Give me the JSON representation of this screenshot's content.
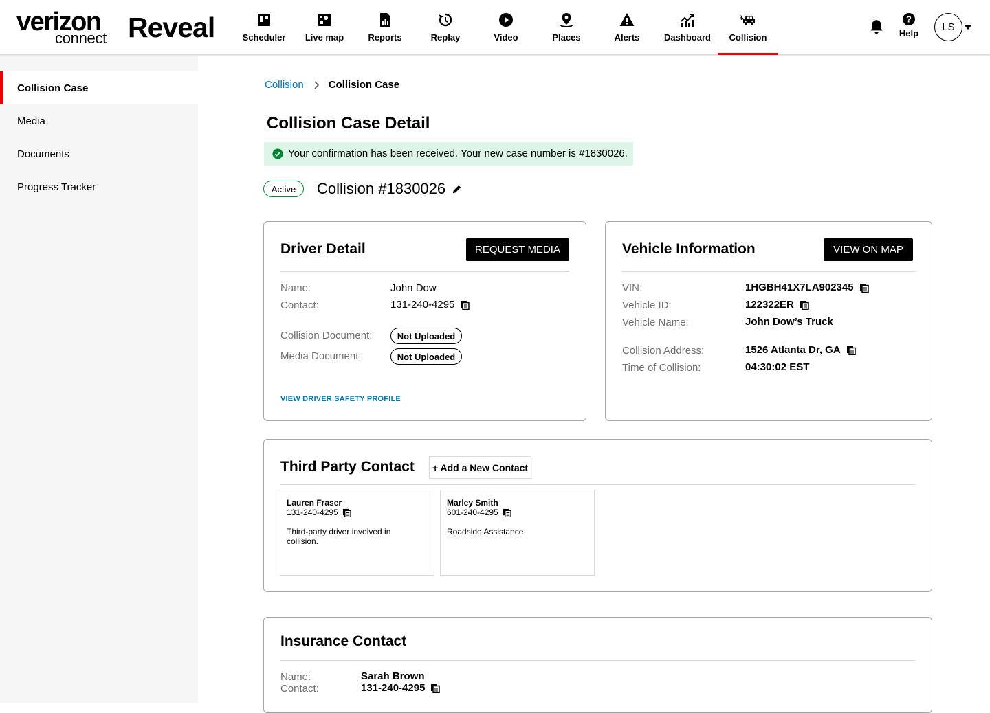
{
  "header": {
    "logo_main": "verizon",
    "logo_sub": "connect",
    "brand": "Reveal",
    "nav": [
      {
        "label": "Scheduler",
        "icon": "scheduler-icon"
      },
      {
        "label": "Live map",
        "icon": "live-map-icon"
      },
      {
        "label": "Reports",
        "icon": "reports-icon"
      },
      {
        "label": "Replay",
        "icon": "replay-icon"
      },
      {
        "label": "Video",
        "icon": "video-play-icon"
      },
      {
        "label": "Places",
        "icon": "places-pin-icon"
      },
      {
        "label": "Alerts",
        "icon": "alert-triangle-icon"
      },
      {
        "label": "Dashboard",
        "icon": "dashboard-chart-icon"
      },
      {
        "label": "Collision",
        "icon": "collision-car-icon",
        "active": true
      }
    ],
    "help_label": "Help",
    "avatar_initials": "LS"
  },
  "sidebar": {
    "items": [
      {
        "label": "Collision Case",
        "active": true
      },
      {
        "label": "Media"
      },
      {
        "label": "Documents"
      },
      {
        "label": "Progress Tracker"
      }
    ]
  },
  "breadcrumb": {
    "parent": "Collision",
    "current": "Collision Case"
  },
  "page": {
    "title": "Collision Case Detail",
    "alert": "Your confirmation has been received. Your new case number is #1830026.",
    "status": "Active",
    "case_title": "Collision #1830026"
  },
  "driver": {
    "title": "Driver Detail",
    "button": "REQUEST MEDIA",
    "name_label": "Name:",
    "name": "John Dow",
    "contact_label": "Contact:",
    "contact": "131-240-4295",
    "collision_doc_label": "Collision Document:",
    "collision_doc_status": "Not Uploaded",
    "media_doc_label": "Media Document:",
    "media_doc_status": "Not Uploaded",
    "link": "VIEW DRIVER SAFETY PROFILE"
  },
  "vehicle": {
    "title": "Vehicle Information",
    "button": "VIEW ON MAP",
    "vin_label": "VIN:",
    "vin": "1HGBH41X7LA902345",
    "id_label": "Vehicle ID:",
    "id": "122322ER",
    "name_label": "Vehicle Name:",
    "name": "John Dow’s Truck",
    "address_label": "Collision Address:",
    "address": "1526 Atlanta Dr, GA",
    "time_label": "Time of Collision:",
    "time": "04:30:02 EST"
  },
  "third_party": {
    "title": "Third Party Contact",
    "add_button": "+ Add a New Contact",
    "contacts": [
      {
        "name": "Lauren Fraser",
        "phone": "131-240-4295",
        "desc": "Third-party driver involved in collision."
      },
      {
        "name": "Marley Smith",
        "phone": "601-240-4295",
        "desc": "Roadside Assistance"
      }
    ]
  },
  "insurance": {
    "title": "Insurance Contact",
    "name_label": "Name:",
    "name": "Sarah Brown",
    "contact_label": "Contact:",
    "contact": "131-240-4295"
  },
  "colors": {
    "accent_red": "#ee0000",
    "link_blue": "#0077b4",
    "success_bg": "#dcf5e6",
    "success_green": "#008331"
  }
}
